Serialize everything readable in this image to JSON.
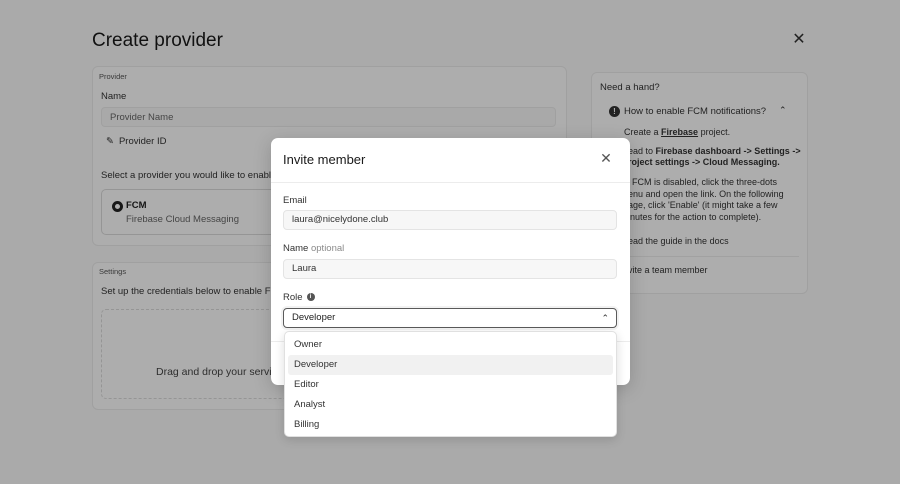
{
  "page": {
    "title": "Create provider",
    "provider_section": {
      "section_label": "Provider",
      "name_label": "Name",
      "name_placeholder": "Provider Name",
      "provider_id_label": "Provider ID",
      "select_text": "Select a provider you would like to enable t",
      "option_title": "FCM",
      "option_subtitle": "Firebase Cloud Messaging"
    },
    "settings_section": {
      "section_label": "Settings",
      "instructions": "Set up the credentials below to enable FCM",
      "dropzone_text": "Drag and drop your servic"
    },
    "help": {
      "title": "Need a hand?",
      "accordion_title": "How to enable FCM notifications?",
      "step1_prefix": "Create a ",
      "step1_link": "Firebase",
      "step1_suffix": " project.",
      "step2_line1_prefix": "ead to ",
      "step2_line1_bold": "Firebase dashboard -> Settings ->",
      "step2_line2_bold": "roject settings -> Cloud Messaging.",
      "step3_line1": "FCM is disabled, click the three-dots",
      "step3_line2": "enu and open the link. On the following",
      "step3_line3": "age, click 'Enable' (it might take a few",
      "step3_line4": "inutes for the action to complete).",
      "step4": "ead the guide in the docs",
      "invite_link": "vite a team member"
    }
  },
  "modal": {
    "title": "Invite member",
    "email_label": "Email",
    "email_value": "laura@nicelydone.club",
    "name_label": "Name",
    "name_optional": "optional",
    "name_value": "Laura",
    "role_label": "Role",
    "role_value": "Developer",
    "role_options": [
      "Owner",
      "Developer",
      "Editor",
      "Analyst",
      "Billing"
    ]
  },
  "icons": {
    "close": "close-icon",
    "pencil": "pencil-icon",
    "info": "info-icon",
    "chevron_up": "chevron-up-icon"
  }
}
